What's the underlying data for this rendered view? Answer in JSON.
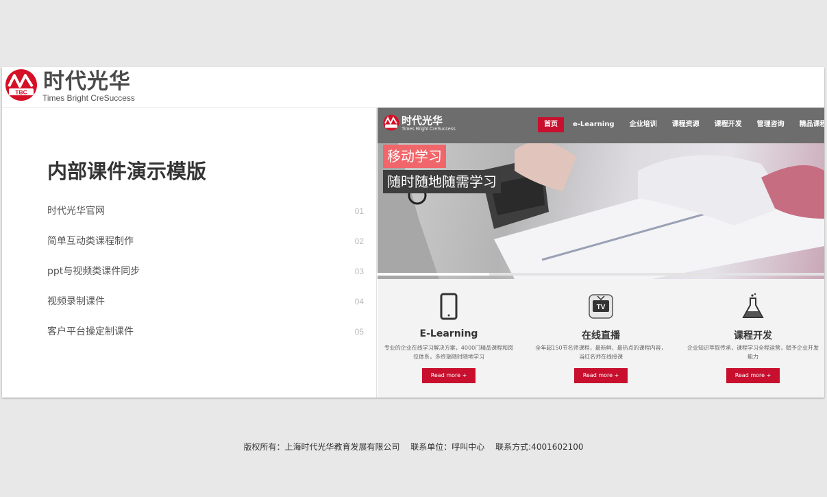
{
  "logo": {
    "cn": "时代光华",
    "en": "Times Bright CreSuccess",
    "mark": "TBC"
  },
  "left": {
    "title": "内部课件演示模版",
    "menu": [
      {
        "label": "时代光华官网",
        "num": "01"
      },
      {
        "label": "简单互动类课程制作",
        "num": "02"
      },
      {
        "label": "ppt与视频类课件同步",
        "num": "03"
      },
      {
        "label": "视频录制课件",
        "num": "04"
      },
      {
        "label": "客户平台操定制课件",
        "num": "05"
      }
    ]
  },
  "preview": {
    "nav": [
      "首页",
      "e-Learning",
      "企业培训",
      "课程资源",
      "课程开发",
      "管理咨询",
      "精品课程"
    ],
    "banner": {
      "tag1": "移动学习",
      "tag2": "随时随地随需学习",
      "progress": 0.25
    },
    "cards": [
      {
        "icon": "tablet-icon",
        "title": "E-Learning",
        "desc": "专业的企业在线学习解决方案，4000门精品课程和岗位体系，多终端随时随地学习",
        "button": "Read more +"
      },
      {
        "icon": "tv-icon",
        "title": "在线直播",
        "desc": "全年超150节名师课程，最新鲜、最热点的课程内容，当红名师在线授课",
        "button": "Read more +"
      },
      {
        "icon": "flask-icon",
        "title": "课程开发",
        "desc": "企业知识萃取传承，课程学习全程运营，赋予企业开发能力",
        "button": "Read more +"
      }
    ]
  },
  "footer": {
    "copyright": "版权所有：上海时代光华教育发展有限公司",
    "unit": "联系单位：呼叫中心",
    "contact": "联系方式:4001602100"
  },
  "colors": {
    "accent": "#c8102e",
    "tag_pink": "#f0666a",
    "nav_bg": "#6d6d6d"
  }
}
